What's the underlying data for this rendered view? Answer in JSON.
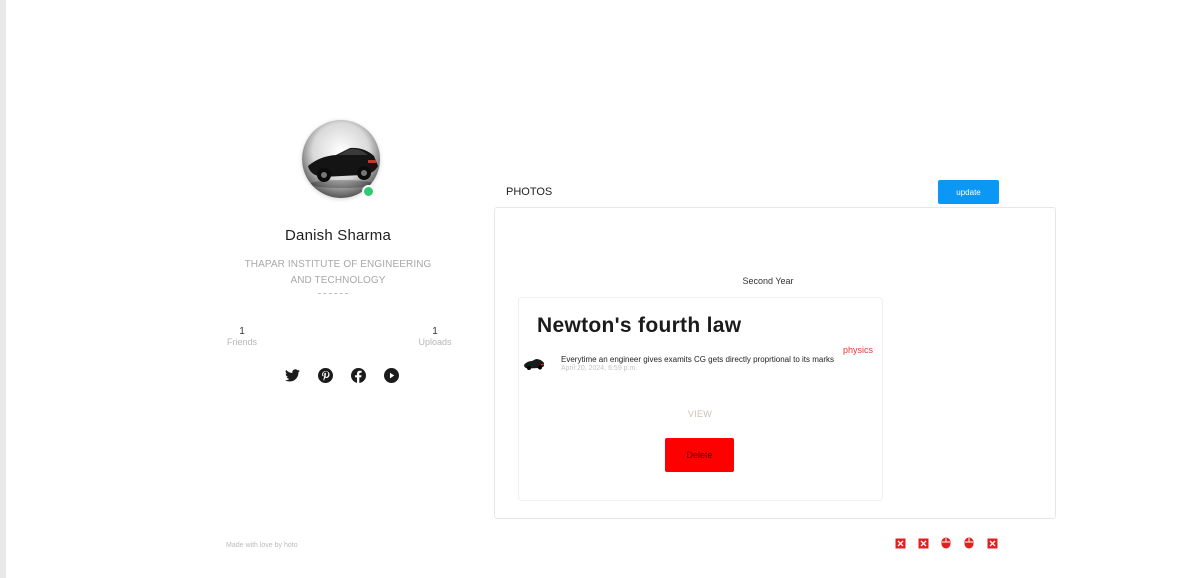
{
  "profile": {
    "name": "Danish Sharma",
    "institute": "THAPAR INSTITUTE OF ENGINEERING AND TECHNOLOGY",
    "stats": [
      {
        "value": "1",
        "label": "Friends"
      },
      {
        "value": "1",
        "label": "Uploads"
      }
    ],
    "status_color": "#2ecc71",
    "social_icons": [
      "twitter-icon",
      "pinterest-icon",
      "facebook-icon",
      "youtube-icon"
    ]
  },
  "photos": {
    "title": "PHOTOS",
    "update_label": "update",
    "year_label": "Second Year",
    "post": {
      "title": "Newton's fourth law",
      "tag": "physics",
      "text": "Everytime an engineer gives examits CG gets directly proprtional to its marks",
      "date": "April 20, 2024, 6:59 p.m.",
      "view_label": "VIEW",
      "delete_label": "Delete"
    }
  },
  "footer": {
    "credit": "Made with love by hoto",
    "icons": [
      "close-box-icon",
      "close-box-icon",
      "mouse-icon",
      "mouse-icon",
      "close-box-icon"
    ]
  },
  "colors": {
    "accent": "#0b98f5",
    "danger": "#ff0000",
    "tag": "#e53935"
  }
}
